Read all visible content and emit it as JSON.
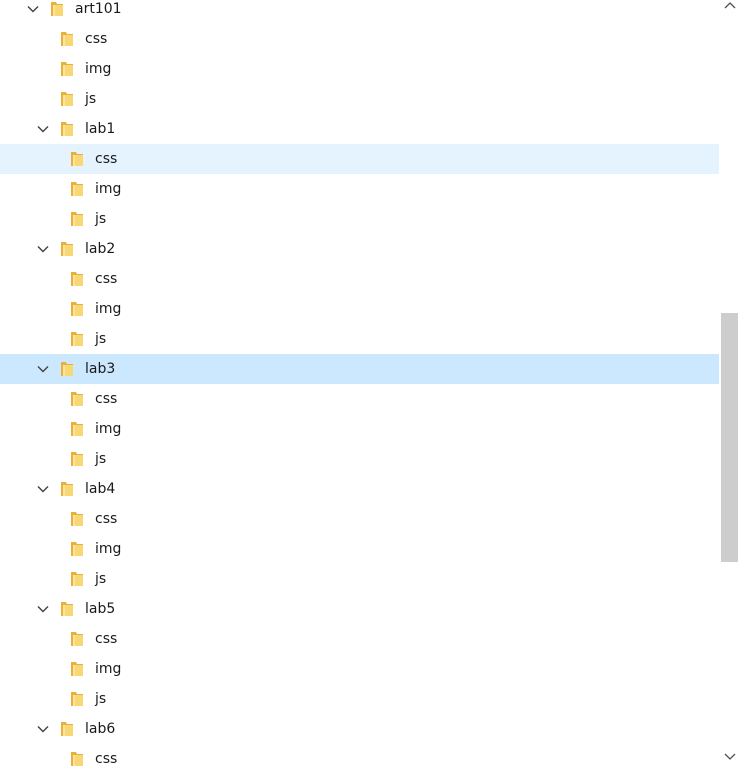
{
  "colors": {
    "hover_row": "#e5f3ff",
    "selected_row": "#cce8ff",
    "folder": "#f5c542",
    "scroll_thumb": "#cdcdcd"
  },
  "tree": {
    "rows": [
      {
        "label": "art101",
        "level": 0,
        "expanded": true,
        "state": ""
      },
      {
        "label": "css",
        "level": 1,
        "state": ""
      },
      {
        "label": "img",
        "level": 1,
        "state": ""
      },
      {
        "label": "js",
        "level": 1,
        "state": ""
      },
      {
        "label": "lab1",
        "level": 1,
        "expanded": true,
        "state": ""
      },
      {
        "label": "css",
        "level": 2,
        "state": "hover"
      },
      {
        "label": "img",
        "level": 2,
        "state": ""
      },
      {
        "label": "js",
        "level": 2,
        "state": ""
      },
      {
        "label": "lab2",
        "level": 1,
        "expanded": true,
        "state": ""
      },
      {
        "label": "css",
        "level": 2,
        "state": ""
      },
      {
        "label": "img",
        "level": 2,
        "state": ""
      },
      {
        "label": "js",
        "level": 2,
        "state": ""
      },
      {
        "label": "lab3",
        "level": 1,
        "expanded": true,
        "state": "selected"
      },
      {
        "label": "css",
        "level": 2,
        "state": ""
      },
      {
        "label": "img",
        "level": 2,
        "state": ""
      },
      {
        "label": "js",
        "level": 2,
        "state": ""
      },
      {
        "label": "lab4",
        "level": 1,
        "expanded": true,
        "state": ""
      },
      {
        "label": "css",
        "level": 2,
        "state": ""
      },
      {
        "label": "img",
        "level": 2,
        "state": ""
      },
      {
        "label": "js",
        "level": 2,
        "state": ""
      },
      {
        "label": "lab5",
        "level": 1,
        "expanded": true,
        "state": ""
      },
      {
        "label": "css",
        "level": 2,
        "state": ""
      },
      {
        "label": "img",
        "level": 2,
        "state": ""
      },
      {
        "label": "js",
        "level": 2,
        "state": ""
      },
      {
        "label": "lab6",
        "level": 1,
        "expanded": true,
        "state": ""
      },
      {
        "label": "css",
        "level": 2,
        "state": ""
      }
    ]
  },
  "icons": {
    "folder": "folder-icon",
    "expand": "chevron-down-icon",
    "scroll_up": "scroll-up-arrow-icon",
    "scroll_down": "scroll-down-arrow-icon"
  }
}
